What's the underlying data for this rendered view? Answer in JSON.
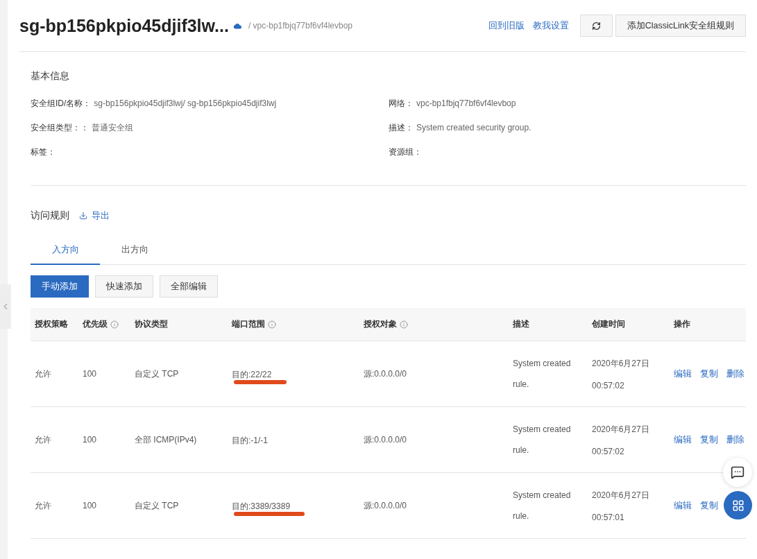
{
  "header": {
    "title": "sg-bp156pkpio45djif3lw...",
    "vpc": "/ vpc-bp1fbjq77bf6vf4levbop",
    "links": [
      "回到旧版",
      "教我设置"
    ],
    "add_button": "添加ClassicLink安全组规则"
  },
  "basic_info": {
    "title": "基本信息",
    "fields": [
      {
        "label": "安全组ID/名称：",
        "value": "sg-bp156pkpio45djif3lwj/ sg-bp156pkpio45djif3lwj"
      },
      {
        "label": "网络：",
        "value": "vpc-bp1fbjq77bf6vf4levbop"
      },
      {
        "label": "安全组类型：：",
        "value": "普通安全组"
      },
      {
        "label": "描述：",
        "value": "System created security group."
      },
      {
        "label": "标签："
      },
      {
        "label": "资源组："
      }
    ]
  },
  "rules": {
    "title": "访问规则",
    "export": "导出",
    "tabs": [
      {
        "label": "入方向",
        "selected": true
      },
      {
        "label": "出方向",
        "selected": false
      }
    ],
    "buttons": [
      {
        "label": "手动添加",
        "primary": true
      },
      {
        "label": "快速添加",
        "primary": false
      },
      {
        "label": "全部编辑",
        "primary": false
      }
    ],
    "columns": [
      {
        "label": "授权策略",
        "info": false
      },
      {
        "label": "优先级",
        "info": true
      },
      {
        "label": "协议类型",
        "info": false
      },
      {
        "label": "端口范围",
        "info": true
      },
      {
        "label": "授权对象",
        "info": true
      },
      {
        "label": "描述",
        "info": false
      },
      {
        "label": "创建时间",
        "info": false
      },
      {
        "label": "操作",
        "info": false
      }
    ],
    "rows": [
      {
        "policy": "允许",
        "priority": "100",
        "protocol": "自定义 TCP",
        "port": "目的:22/22",
        "underlined": true,
        "source": "源:0.0.0.0/0",
        "description": [
          "System created",
          "rule."
        ],
        "created": [
          "2020年6月27日",
          "00:57:02"
        ],
        "actions": [
          "编辑",
          "复制",
          "删除"
        ]
      },
      {
        "policy": "允许",
        "priority": "100",
        "protocol": "全部 ICMP(IPv4)",
        "port": "目的:-1/-1",
        "underlined": false,
        "source": "源:0.0.0.0/0",
        "description": [
          "System created",
          "rule."
        ],
        "created": [
          "2020年6月27日",
          "00:57:02"
        ],
        "actions": [
          "编辑",
          "复制",
          "删除"
        ]
      },
      {
        "policy": "允许",
        "priority": "100",
        "protocol": "自定义 TCP",
        "port": "目的:3389/3389",
        "underlined": true,
        "source": "源:0.0.0.0/0",
        "description": [
          "System created",
          "rule."
        ],
        "created": [
          "2020年6月27日",
          "00:57:01"
        ],
        "actions": [
          "编辑",
          "复制"
        ]
      }
    ]
  }
}
